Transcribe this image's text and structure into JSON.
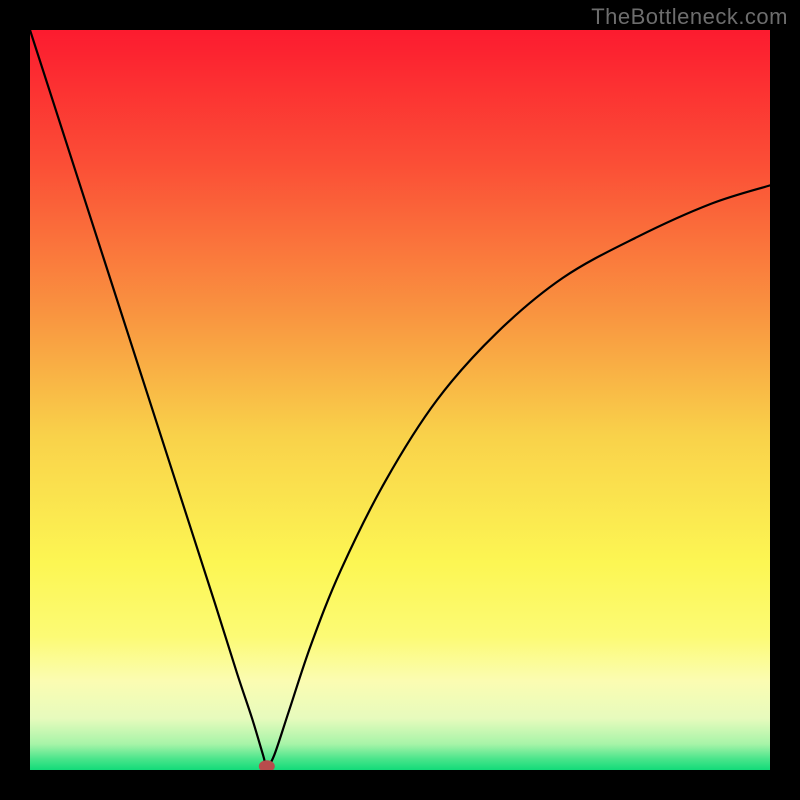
{
  "watermark": "TheBottleneck.com",
  "chart_data": {
    "type": "line",
    "title": "",
    "xlabel": "",
    "ylabel": "",
    "xlim": [
      0,
      100
    ],
    "ylim": [
      0,
      100
    ],
    "series": [
      {
        "name": "bottleneck-curve",
        "x": [
          0,
          5,
          10,
          15,
          20,
          25,
          28,
          30,
          31.5,
          32,
          33,
          35,
          38,
          42,
          48,
          55,
          63,
          72,
          82,
          92,
          100
        ],
        "y": [
          100,
          84.5,
          69,
          53.5,
          38,
          22.5,
          13,
          7,
          2,
          0.5,
          2,
          8,
          17,
          27,
          39,
          50,
          59,
          66.5,
          72,
          76.5,
          79
        ],
        "color": "#000000"
      }
    ],
    "marker": {
      "name": "current-point",
      "x": 32,
      "y": 0.5,
      "color": "#b84c4c"
    },
    "background_gradient": {
      "stops": [
        {
          "offset": 0.0,
          "color": "#fc1b2f"
        },
        {
          "offset": 0.18,
          "color": "#fb4e36"
        },
        {
          "offset": 0.38,
          "color": "#f99340"
        },
        {
          "offset": 0.55,
          "color": "#f9d24a"
        },
        {
          "offset": 0.72,
          "color": "#fcf653"
        },
        {
          "offset": 0.82,
          "color": "#fcfb75"
        },
        {
          "offset": 0.88,
          "color": "#fbfcb2"
        },
        {
          "offset": 0.93,
          "color": "#e7fbbd"
        },
        {
          "offset": 0.965,
          "color": "#a7f4a8"
        },
        {
          "offset": 0.985,
          "color": "#4ae58b"
        },
        {
          "offset": 1.0,
          "color": "#13db79"
        }
      ]
    }
  }
}
